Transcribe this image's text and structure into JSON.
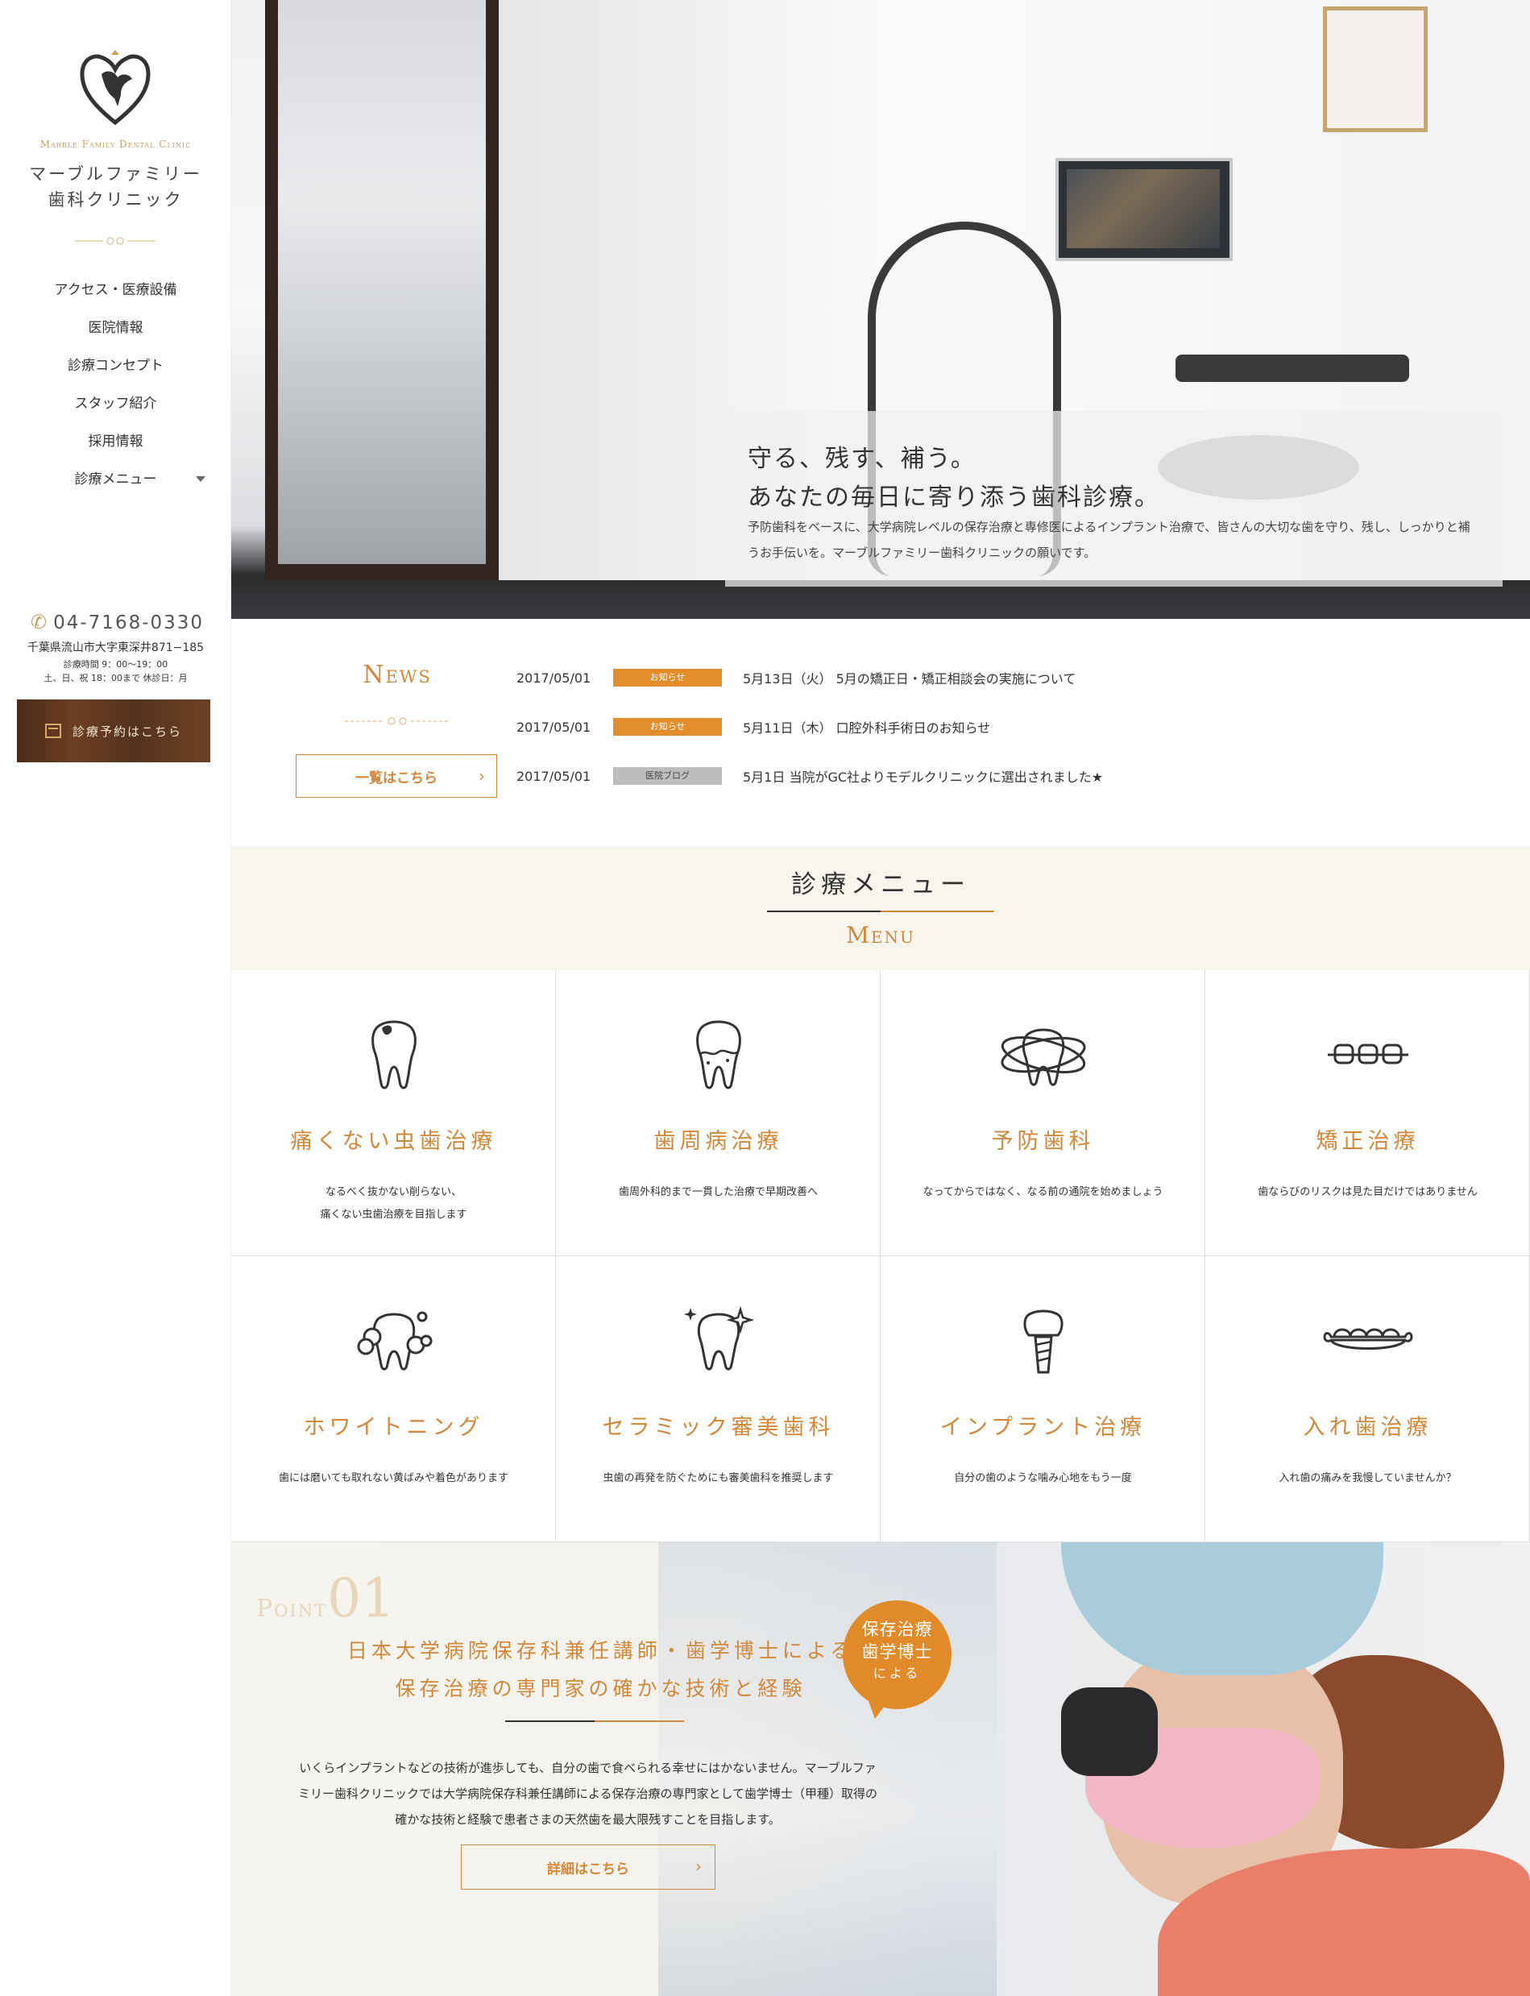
{
  "sidebar": {
    "logo_en": "Marble Family Dental Clinic",
    "logo_ja_line1": "マーブルファミリー",
    "logo_ja_line2": "歯科クリニック",
    "nav": [
      {
        "label": "アクセス・医療設備"
      },
      {
        "label": "医院情報"
      },
      {
        "label": "診療コンセプト"
      },
      {
        "label": "スタッフ紹介"
      },
      {
        "label": "採用情報"
      },
      {
        "label": "診療メニュー",
        "has_dropdown": true
      }
    ],
    "phone": "04-7168-0330",
    "address": "千葉県流山市大字東深井871−185",
    "hours_1": "診療時間 9：00〜19：00",
    "hours_2": "土、日、祝 18：00まで 休診日：月",
    "reserve_label": "診療予約はこちら"
  },
  "hero": {
    "headline_1": "守る、残す、補う。",
    "headline_2": "あなたの毎日に寄り添う歯科診療。",
    "body": "予防歯科をベースに、大学病院レベルの保存治療と専修医によるインプラント治療で、皆さんの大切な歯を守り、残し、しっかりと補うお手伝いを。マーブルファミリー歯科クリニックの願いです。"
  },
  "news": {
    "title": "News",
    "more_label": "一覧はこちら",
    "items": [
      {
        "date": "2017/05/01",
        "tag": "お知らせ",
        "tag_color": "#e28c2a",
        "title": "5月13日（火） 5月の矯正日・矯正相談会の実施について"
      },
      {
        "date": "2017/05/01",
        "tag": "お知らせ",
        "tag_color": "#e28c2a",
        "title": "5月11日（木） 口腔外科手術日のお知らせ"
      },
      {
        "date": "2017/05/01",
        "tag": "医院ブログ",
        "tag_color": "#bdbdbd",
        "title": "5月1日 当院がGC社よりモデルクリニックに選出されました★"
      }
    ]
  },
  "menu": {
    "title_ja": "診療メニュー",
    "title_en": "Menu",
    "items": [
      {
        "icon": "cavity-tooth-icon",
        "title": "痛くない虫歯治療",
        "desc_1": "なるべく抜かない削らない、",
        "desc_2": "痛くない虫歯治療を目指します"
      },
      {
        "icon": "periodontal-tooth-icon",
        "title": "歯周病治療",
        "desc_1": "歯周外科的まで一貫した治療で早期改善へ",
        "desc_2": ""
      },
      {
        "icon": "protected-tooth-icon",
        "title": "予防歯科",
        "desc_1": "なってからではなく、なる前の通院を始めましょう",
        "desc_2": ""
      },
      {
        "icon": "braces-icon",
        "title": "矯正治療",
        "desc_1": "歯ならびのリスクは見た目だけではありません",
        "desc_2": ""
      },
      {
        "icon": "whitening-tooth-icon",
        "title": "ホワイトニング",
        "desc_1": "歯には磨いても取れない黄ばみや着色があります",
        "desc_2": ""
      },
      {
        "icon": "sparkle-tooth-icon",
        "title": "セラミック審美歯科",
        "desc_1": "虫歯の再発を防ぐためにも審美歯科を推奨します",
        "desc_2": ""
      },
      {
        "icon": "implant-icon",
        "title": "インプラント治療",
        "desc_1": "自分の歯のような噛み心地をもう一度",
        "desc_2": ""
      },
      {
        "icon": "denture-icon",
        "title": "入れ歯治療",
        "desc_1": "入れ歯の痛みを我慢していませんか？",
        "desc_2": ""
      }
    ]
  },
  "point": {
    "label": "Point",
    "number": "01",
    "heading_1": "日本大学病院保存科兼任講師・歯学博士による",
    "heading_2": "保存治療の専門家の確かな技術と経験",
    "badge_1": "保存治療",
    "badge_2": "歯学博士",
    "badge_3": "による",
    "body": "いくらインプラントなどの技術が進歩しても、自分の歯で食べられる幸せにはかないません。マーブルファミリー歯科クリニックでは大学病院保存科兼任講師による保存治療の専門家として歯学博士（甲種）取得の確かな技術と経験で患者さまの天然歯を最大限残すことを目指します。",
    "button_label": "詳細はこちら"
  },
  "colors": {
    "accent": "#d2883a",
    "badge": "#e18a29",
    "gold": "#c9a063",
    "brown": "#5a341d"
  }
}
